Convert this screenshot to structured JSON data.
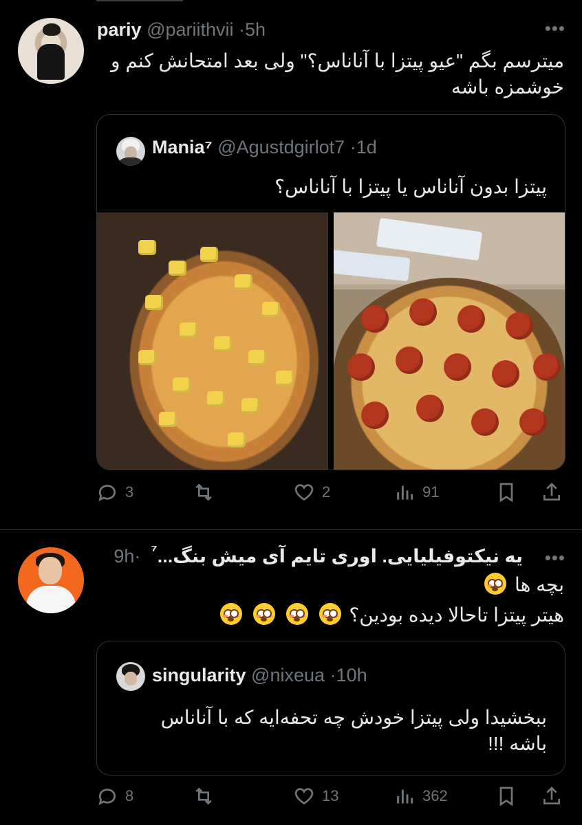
{
  "tweets": [
    {
      "author": {
        "name": "pariy",
        "handle": "@pariithvii",
        "time": "5h"
      },
      "text": "میترسم بگم \"عیو پیتزا با آناناس؟\" ولی بعد امتحانش کنم و خوشمزه باشه",
      "quote": {
        "author": {
          "name": "Mania⁷",
          "handle": "@Agustdgirlot7",
          "time": "1d"
        },
        "text": "پیتزا بدون آناناس یا پیتزا با آناناس؟"
      },
      "stats": {
        "replies": "3",
        "retweets": "",
        "likes": "2",
        "views": "91"
      }
    },
    {
      "author": {
        "name": "یه نیکتوفیلیایی. اوری تایم آی میش بنگ...",
        "badge": "⁷",
        "handle": "",
        "time": "9h"
      },
      "text_line1": "بچه ها",
      "text_line2": "هیتر پیتزا تاحالا دیده بودین؟",
      "quote": {
        "author": {
          "name": "singularity",
          "handle": "@nixeua",
          "time": "10h"
        },
        "text": "ببخشیدا ولی پیتزا خودش چه تحفه‌ایه که با آناناس باشه !!!"
      },
      "stats": {
        "replies": "8",
        "retweets": "",
        "likes": "13",
        "views": "362"
      }
    }
  ],
  "icons": {
    "reply": "reply-icon",
    "retweet": "retweet-icon",
    "like": "heart-icon",
    "views": "views-icon",
    "bookmark": "bookmark-icon",
    "share": "share-icon",
    "more": "more-icon",
    "emoji": "flushed-face-emoji"
  }
}
